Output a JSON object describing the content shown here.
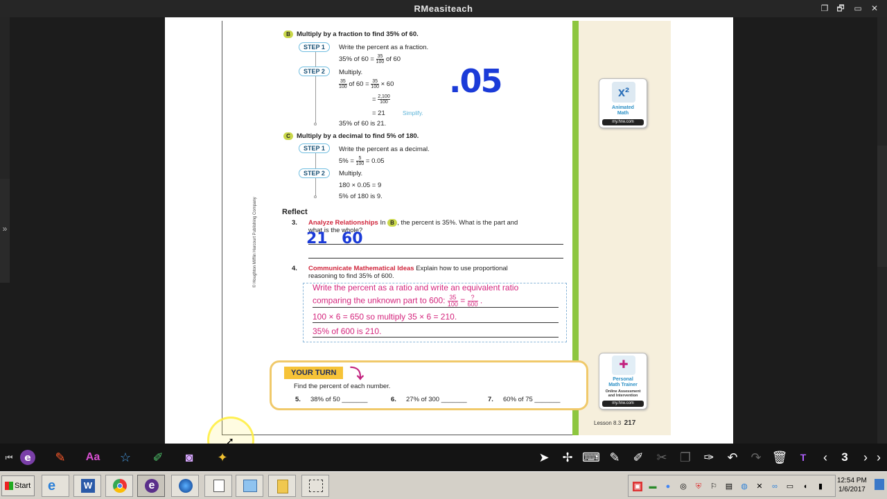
{
  "app": {
    "title": "RMeasiteach"
  },
  "window_controls": {
    "restore": "❐",
    "maximize": "🗗",
    "minimize": "▭",
    "close": "✕"
  },
  "left_handle": {
    "label": "»"
  },
  "lesson": {
    "partB": {
      "letter": "B",
      "heading": "Multiply by a fraction to find 35% of 60.",
      "step1_label": "STEP 1",
      "step1_text": "Write the percent as a fraction.",
      "step1_eq_prefix": "35% of 60 =",
      "step1_eq_num": "35",
      "step1_eq_den": "100",
      "step1_eq_suffix": "of 60",
      "step2_label": "STEP 2",
      "step2_text": "Multiply.",
      "eq1_num": "35",
      "eq1_den": "100",
      "eq1_mid": "of 60 =",
      "eq1_num2": "35",
      "eq1_den2": "100",
      "eq1_suffix": "× 60",
      "eq2_prefix": "=",
      "eq2_num": "2,100",
      "eq2_den": "100",
      "eq3": "= 21",
      "simplify": "Simplify.",
      "result": "35% of 60 is 21."
    },
    "partC": {
      "letter": "C",
      "heading": "Multiply by a decimal to find 5% of 180.",
      "step1_label": "STEP 1",
      "step1_text": "Write the percent as a decimal.",
      "eq_prefix": "5% =",
      "eq_num": "5",
      "eq_den": "100",
      "eq_suffix": "= 0.05",
      "step2_label": "STEP 2",
      "step2_text": "Multiply.",
      "eq2": "180 × 0.05 = 9",
      "result": "5% of 180 is 9."
    },
    "reflect": {
      "heading": "Reflect",
      "q3_num": "3.",
      "q3_title": "Analyze Relationships",
      "q3_text_a": "In",
      "q3_badge": "B",
      "q3_text_b": ", the percent is 35%. What is the part and",
      "q3_text_c": "what is the whole?",
      "q4_num": "4.",
      "q4_title": "Communicate Mathematical Ideas",
      "q4_text_a": "Explain how to use proportional",
      "q4_text_b": "reasoning to find 35% of 600."
    },
    "answer4": {
      "line1": "Write the percent as a ratio and write an equivalent ratio",
      "line2_prefix": "comparing the unknown part to 600:",
      "line2_num1": "35",
      "line2_den1": "100",
      "line2_eq": "=",
      "line2_num2": "?",
      "line2_den2": "600",
      "line2_suffix": ".",
      "line3": "100 × 6 = 650 so multiply 35 × 6 = 210.",
      "line4": "35% of 600 is 210."
    },
    "handwriting": {
      "top": ".05",
      "part": "21",
      "whole": "60"
    },
    "your_turn": {
      "label": "YOUR TURN",
      "instruction": "Find the percent of each number.",
      "q5_num": "5.",
      "q5_text": "38% of 50 _______",
      "q6_num": "6.",
      "q6_text": "27% of 300 _______",
      "q7_num": "7.",
      "q7_text": "60% of 75 _______"
    },
    "animated_math": {
      "icon": "x²",
      "label1": "Animated",
      "label2": "Math",
      "url": "my.hrw.com"
    },
    "pmt": {
      "label1": "Personal",
      "label2": "Math Trainer",
      "sub1": "Online Assessment",
      "sub2": "and Intervention",
      "url": "my.hrw.com"
    },
    "footer": {
      "lesson": "Lesson 8.3",
      "page": "217"
    },
    "copyright": "© Houghton Mifflin Harcourt Publishing Company"
  },
  "toolbar": {
    "collapse": "⏮",
    "page_number": "3",
    "prev": "‹",
    "next": "›",
    "more": "›"
  },
  "taskbar": {
    "start_label": "Start",
    "clock_time": "12:54 PM",
    "clock_date": "1/6/2017"
  },
  "colors": {
    "accent_green": "#8dc63f",
    "pink_answer": "#d4247c",
    "ink_blue": "#1b3bd8"
  }
}
